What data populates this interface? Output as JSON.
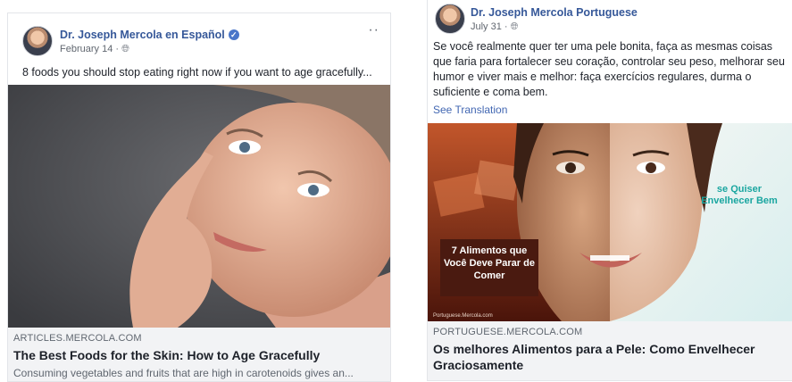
{
  "post1": {
    "page_name": "Dr. Joseph Mercola en Español",
    "date": "February 14",
    "text": "8 foods you should stop eating right now if you want to age gracefully...",
    "link": {
      "domain": "ARTICLES.MERCOLA.COM",
      "title": "The Best Foods for the Skin: How to Age Gracefully",
      "description": "Consuming vegetables and fruits that are high in carotenoids gives an..."
    }
  },
  "post2": {
    "page_name": "Dr. Joseph Mercola Portuguese",
    "date": "July 31",
    "text": "Se você realmente quer ter uma pele bonita, faça as mesmas coisas que faria para fortalecer seu coração, controlar seu peso, melhorar seu humor e viver mais e melhor: faça exercícios regulares, durma o suficiente e coma bem.",
    "see_translation": "See Translation",
    "image_overlay_left": "7 Alimentos que Você Deve Parar de Comer",
    "image_overlay_right": "se Quiser Envelhecer Bem",
    "image_watermark": "Portuguese.Mercola.com",
    "link": {
      "domain": "PORTUGUESE.MERCOLA.COM",
      "title": "Os melhores Alimentos para a Pele: Como Envelhecer Graciosamente"
    }
  }
}
